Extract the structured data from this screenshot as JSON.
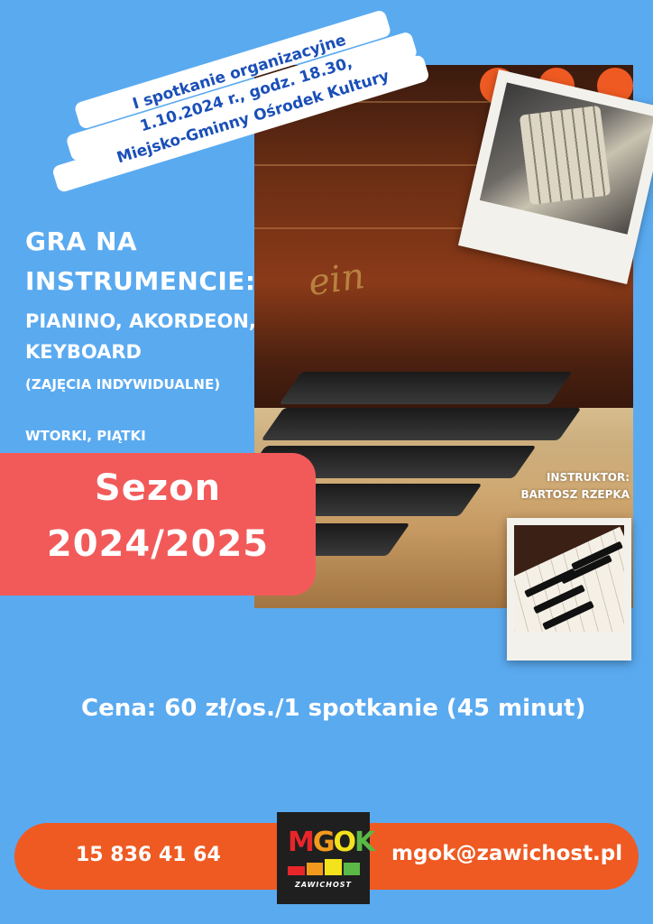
{
  "banner": {
    "line1": "I spotkanie organizacyjne",
    "line2": "1.10.2024 r., godz. 18.30,",
    "line3": "Miejsko-Gminny Ośrodek Kultury"
  },
  "title": {
    "line1": "GRA NA",
    "line2": "INSTRUMENCIE:",
    "line3": "PIANINO, AKORDEON,",
    "line4": "KEYBOARD",
    "note": "(ZAJĘCIA INDYWIDUALNE)"
  },
  "days": "WTORKI, PIĄTKI",
  "season": {
    "line1": "Sezon",
    "line2": "2024/2025"
  },
  "instructor": {
    "label": "INSTRUKTOR:",
    "name": "BARTOSZ RZEPKA"
  },
  "price": "Cena: 60 zł/os./1 spotkanie (45 minut)",
  "footer": {
    "phone": "15 836 41 64",
    "email": "mgok@zawichost.pl"
  },
  "logo": {
    "letters": "MGOK",
    "sub": "ZAWICHOST"
  },
  "colors": {
    "background": "#5aaaf0",
    "accent_orange": "#ef5a22",
    "season_red": "#f25a5a",
    "banner_text": "#1a4fb8"
  }
}
